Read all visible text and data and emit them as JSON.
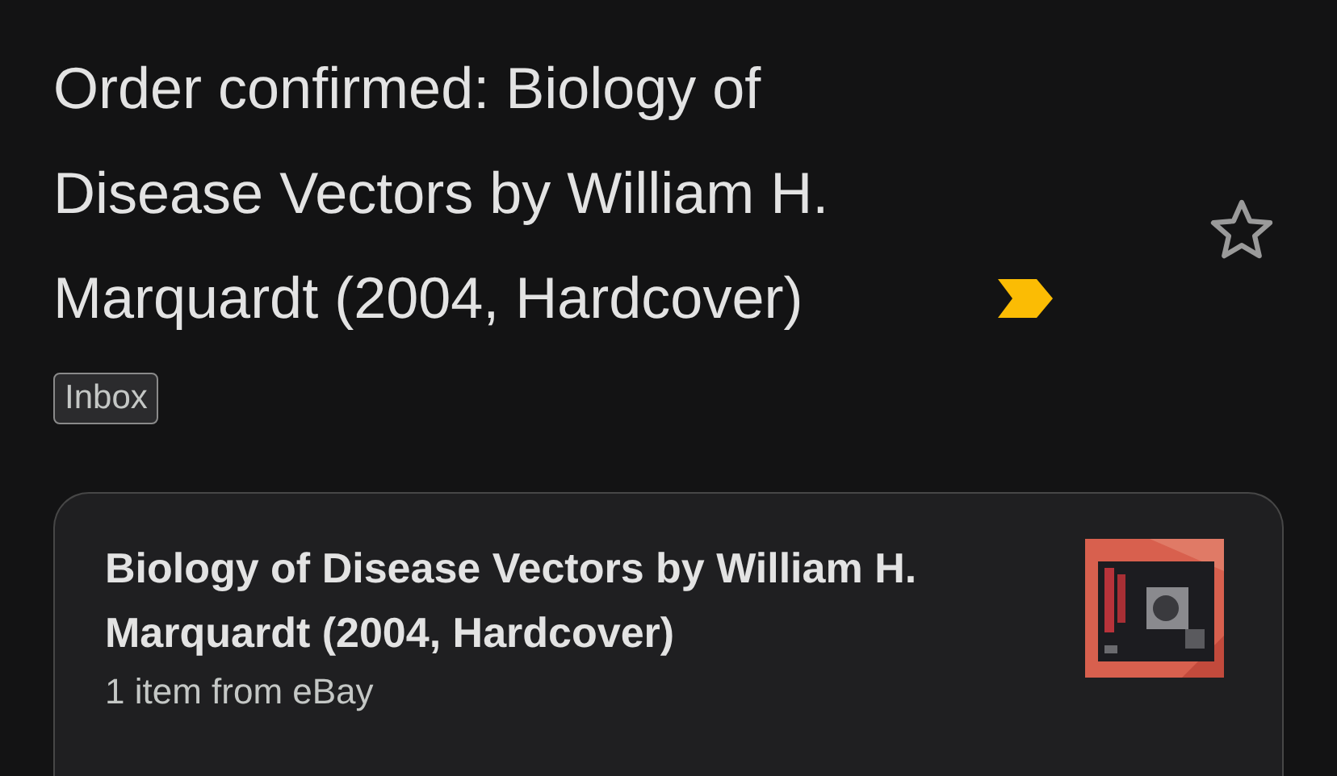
{
  "email": {
    "subject": "Order confirmed: Biology of Disease Vectors by William H. Marquardt (2004, Hardcover)",
    "important": true,
    "starred": false,
    "labels": [
      "Inbox"
    ]
  },
  "order_card": {
    "title": "Biology of Disease Vectors by William H. Marquardt (2004, Hardcover)",
    "subtitle": "1 item from eBay"
  }
}
